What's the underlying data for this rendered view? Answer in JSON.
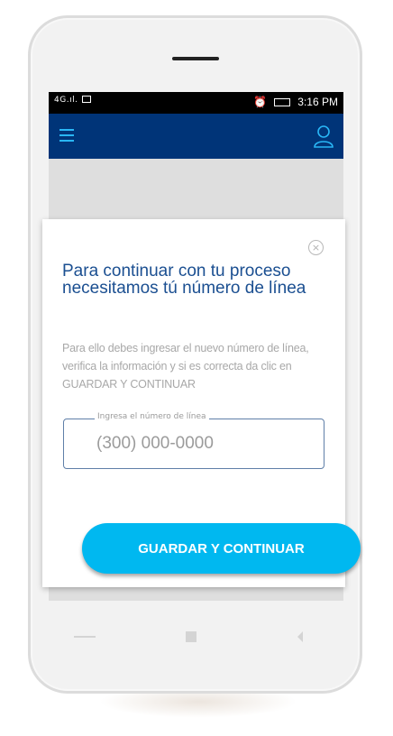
{
  "status_bar": {
    "signal": "4G",
    "time": "3:16 PM"
  },
  "icons": {
    "menu": "hamburger-menu-icon",
    "user": "user-icon",
    "close": "close-icon"
  },
  "modal": {
    "close_glyph": "×",
    "title": "Para continuar con tu proceso necesitamos tú número de línea",
    "description": "Para ello debes ingresar el nuevo número de línea, verifica la información y si es correcta da clic en GUARDAR Y CONTINUAR",
    "field_label": "Ingresa el número de línea",
    "field_placeholder": "(300) 000-0000",
    "field_value": ""
  },
  "cta": {
    "label": "GUARDAR  Y CONTINUAR"
  },
  "colors": {
    "app_bar": "#003478",
    "accent": "#00b8f0",
    "title": "#1b4f91"
  }
}
